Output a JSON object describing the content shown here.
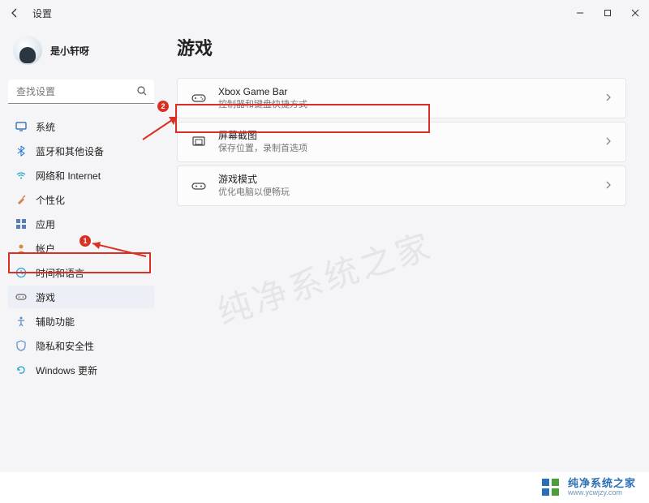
{
  "window": {
    "title": "设置"
  },
  "user": {
    "name": "是小轩呀"
  },
  "search": {
    "placeholder": "查找设置"
  },
  "sidebar": {
    "items": [
      {
        "label": "系统",
        "icon": "system"
      },
      {
        "label": "蓝牙和其他设备",
        "icon": "bluetooth"
      },
      {
        "label": "网络和 Internet",
        "icon": "wifi"
      },
      {
        "label": "个性化",
        "icon": "brush"
      },
      {
        "label": "应用",
        "icon": "apps"
      },
      {
        "label": "帐户",
        "icon": "account"
      },
      {
        "label": "时间和语言",
        "icon": "time"
      },
      {
        "label": "游戏",
        "icon": "game"
      },
      {
        "label": "辅助功能",
        "icon": "accessibility"
      },
      {
        "label": "隐私和安全性",
        "icon": "privacy"
      },
      {
        "label": "Windows 更新",
        "icon": "update"
      }
    ]
  },
  "page": {
    "title": "游戏"
  },
  "cards": [
    {
      "title": "Xbox Game Bar",
      "sub": "控制器和键盘快捷方式"
    },
    {
      "title": "屏幕截图",
      "sub": "保存位置，录制首选项"
    },
    {
      "title": "游戏模式",
      "sub": "优化电脑以便畅玩"
    }
  ],
  "annotations": {
    "badge1": "1",
    "badge2": "2"
  },
  "watermark": {
    "brand": "纯净系统之家",
    "url": "www.ycwjzy.com",
    "diag": "纯净系统之家"
  }
}
